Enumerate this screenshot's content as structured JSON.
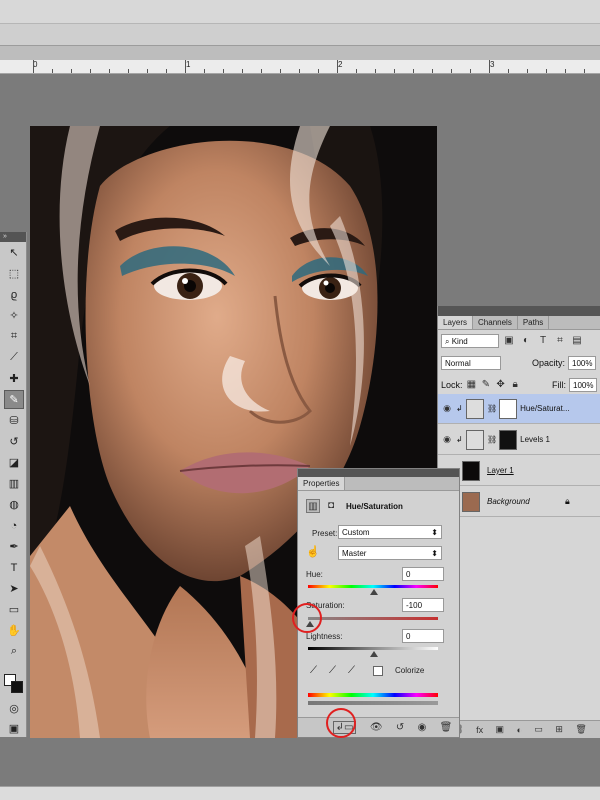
{
  "ruler": {
    "marks": [
      "0",
      "1",
      "2",
      "3"
    ]
  },
  "tools": {
    "items": [
      {
        "name": "move-tool",
        "glyph": "↖"
      },
      {
        "name": "marquee-tool",
        "glyph": "⬚"
      },
      {
        "name": "lasso-tool",
        "glyph": "ϱ"
      },
      {
        "name": "quick-select-tool",
        "glyph": "✧"
      },
      {
        "name": "crop-tool",
        "glyph": "⌗"
      },
      {
        "name": "eyedropper-tool",
        "glyph": "⟋"
      },
      {
        "name": "healing-brush-tool",
        "glyph": "✚"
      },
      {
        "name": "brush-tool",
        "glyph": "✎"
      },
      {
        "name": "clone-stamp-tool",
        "glyph": "⛁"
      },
      {
        "name": "history-brush-tool",
        "glyph": "↺"
      },
      {
        "name": "eraser-tool",
        "glyph": "◪"
      },
      {
        "name": "gradient-tool",
        "glyph": "▥"
      },
      {
        "name": "blur-tool",
        "glyph": "◍"
      },
      {
        "name": "dodge-tool",
        "glyph": "◔"
      },
      {
        "name": "pen-tool",
        "glyph": "✒"
      },
      {
        "name": "type-tool",
        "glyph": "T"
      },
      {
        "name": "path-select-tool",
        "glyph": "➤"
      },
      {
        "name": "shape-tool",
        "glyph": "▭"
      },
      {
        "name": "hand-tool",
        "glyph": "✋"
      },
      {
        "name": "zoom-tool",
        "glyph": "⌕"
      }
    ]
  },
  "layers_panel": {
    "tabs": [
      "Layers",
      "Channels",
      "Paths"
    ],
    "filter": "Kind",
    "blend_mode": "Normal",
    "opacity_label": "Opacity:",
    "opacity": "100%",
    "lock_label": "Lock:",
    "fill_label": "Fill:",
    "fill": "100%",
    "layers": [
      {
        "name": "Hue/Saturat...",
        "selected": true
      },
      {
        "name": "Levels 1",
        "selected": false
      },
      {
        "name": "Layer 1",
        "selected": false
      },
      {
        "name": "Background",
        "selected": false
      }
    ]
  },
  "properties_panel": {
    "title": "Properties",
    "adjustment_name": "Hue/Saturation",
    "preset_label": "Preset:",
    "preset_value": "Custom",
    "channel_value": "Master",
    "hue_label": "Hue:",
    "hue_value": "0",
    "saturation_label": "Saturation:",
    "saturation_value": "-100",
    "lightness_label": "Lightness:",
    "lightness_value": "0",
    "colorize_label": "Colorize"
  },
  "colors": {
    "selected_layer": "#b6c8ec",
    "highlight_circle": "#e02020"
  }
}
